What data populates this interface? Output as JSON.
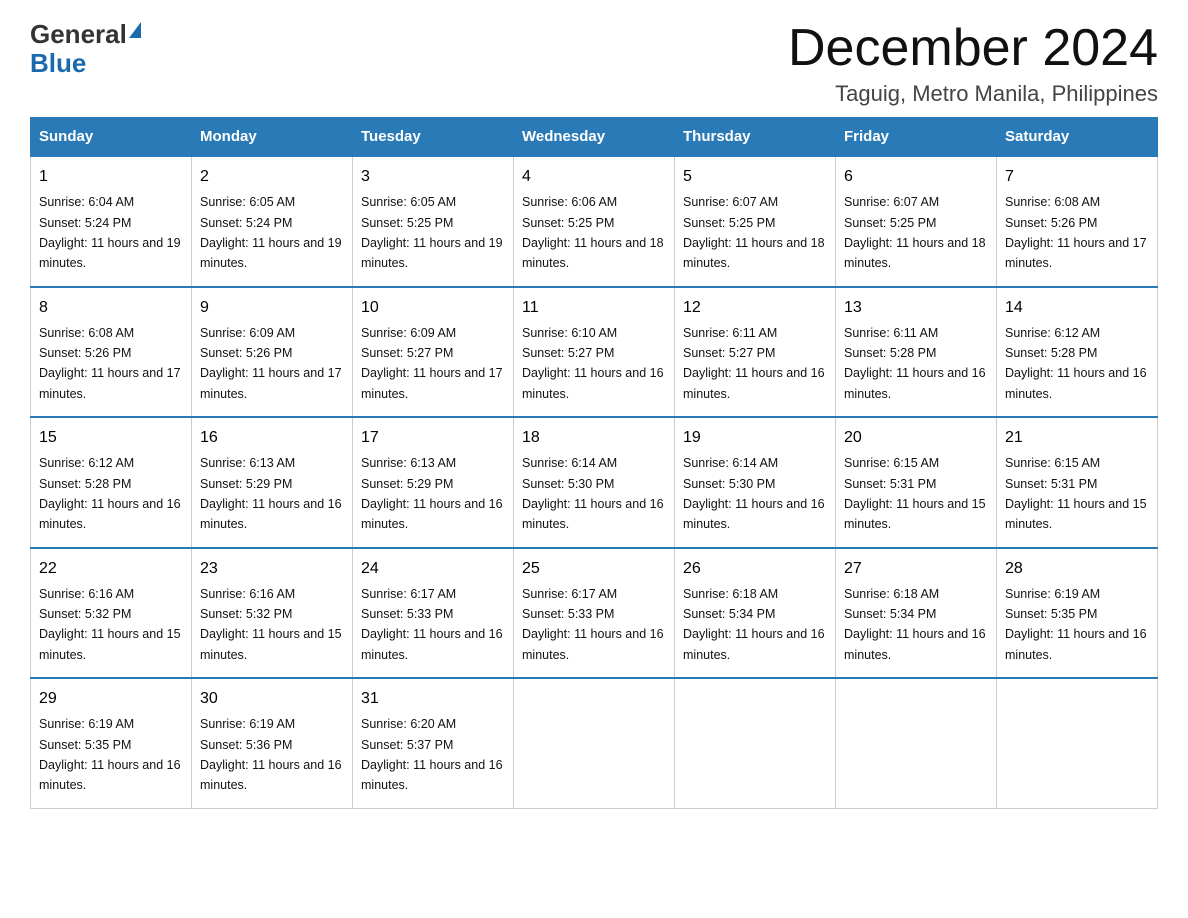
{
  "header": {
    "logo": {
      "general_text": "General",
      "blue_text": "Blue"
    },
    "title": "December 2024",
    "subtitle": "Taguig, Metro Manila, Philippines"
  },
  "calendar": {
    "headers": [
      "Sunday",
      "Monday",
      "Tuesday",
      "Wednesday",
      "Thursday",
      "Friday",
      "Saturday"
    ],
    "weeks": [
      [
        {
          "day": "1",
          "sunrise": "6:04 AM",
          "sunset": "5:24 PM",
          "daylight": "11 hours and 19 minutes."
        },
        {
          "day": "2",
          "sunrise": "6:05 AM",
          "sunset": "5:24 PM",
          "daylight": "11 hours and 19 minutes."
        },
        {
          "day": "3",
          "sunrise": "6:05 AM",
          "sunset": "5:25 PM",
          "daylight": "11 hours and 19 minutes."
        },
        {
          "day": "4",
          "sunrise": "6:06 AM",
          "sunset": "5:25 PM",
          "daylight": "11 hours and 18 minutes."
        },
        {
          "day": "5",
          "sunrise": "6:07 AM",
          "sunset": "5:25 PM",
          "daylight": "11 hours and 18 minutes."
        },
        {
          "day": "6",
          "sunrise": "6:07 AM",
          "sunset": "5:25 PM",
          "daylight": "11 hours and 18 minutes."
        },
        {
          "day": "7",
          "sunrise": "6:08 AM",
          "sunset": "5:26 PM",
          "daylight": "11 hours and 17 minutes."
        }
      ],
      [
        {
          "day": "8",
          "sunrise": "6:08 AM",
          "sunset": "5:26 PM",
          "daylight": "11 hours and 17 minutes."
        },
        {
          "day": "9",
          "sunrise": "6:09 AM",
          "sunset": "5:26 PM",
          "daylight": "11 hours and 17 minutes."
        },
        {
          "day": "10",
          "sunrise": "6:09 AM",
          "sunset": "5:27 PM",
          "daylight": "11 hours and 17 minutes."
        },
        {
          "day": "11",
          "sunrise": "6:10 AM",
          "sunset": "5:27 PM",
          "daylight": "11 hours and 16 minutes."
        },
        {
          "day": "12",
          "sunrise": "6:11 AM",
          "sunset": "5:27 PM",
          "daylight": "11 hours and 16 minutes."
        },
        {
          "day": "13",
          "sunrise": "6:11 AM",
          "sunset": "5:28 PM",
          "daylight": "11 hours and 16 minutes."
        },
        {
          "day": "14",
          "sunrise": "6:12 AM",
          "sunset": "5:28 PM",
          "daylight": "11 hours and 16 minutes."
        }
      ],
      [
        {
          "day": "15",
          "sunrise": "6:12 AM",
          "sunset": "5:28 PM",
          "daylight": "11 hours and 16 minutes."
        },
        {
          "day": "16",
          "sunrise": "6:13 AM",
          "sunset": "5:29 PM",
          "daylight": "11 hours and 16 minutes."
        },
        {
          "day": "17",
          "sunrise": "6:13 AM",
          "sunset": "5:29 PM",
          "daylight": "11 hours and 16 minutes."
        },
        {
          "day": "18",
          "sunrise": "6:14 AM",
          "sunset": "5:30 PM",
          "daylight": "11 hours and 16 minutes."
        },
        {
          "day": "19",
          "sunrise": "6:14 AM",
          "sunset": "5:30 PM",
          "daylight": "11 hours and 16 minutes."
        },
        {
          "day": "20",
          "sunrise": "6:15 AM",
          "sunset": "5:31 PM",
          "daylight": "11 hours and 15 minutes."
        },
        {
          "day": "21",
          "sunrise": "6:15 AM",
          "sunset": "5:31 PM",
          "daylight": "11 hours and 15 minutes."
        }
      ],
      [
        {
          "day": "22",
          "sunrise": "6:16 AM",
          "sunset": "5:32 PM",
          "daylight": "11 hours and 15 minutes."
        },
        {
          "day": "23",
          "sunrise": "6:16 AM",
          "sunset": "5:32 PM",
          "daylight": "11 hours and 15 minutes."
        },
        {
          "day": "24",
          "sunrise": "6:17 AM",
          "sunset": "5:33 PM",
          "daylight": "11 hours and 16 minutes."
        },
        {
          "day": "25",
          "sunrise": "6:17 AM",
          "sunset": "5:33 PM",
          "daylight": "11 hours and 16 minutes."
        },
        {
          "day": "26",
          "sunrise": "6:18 AM",
          "sunset": "5:34 PM",
          "daylight": "11 hours and 16 minutes."
        },
        {
          "day": "27",
          "sunrise": "6:18 AM",
          "sunset": "5:34 PM",
          "daylight": "11 hours and 16 minutes."
        },
        {
          "day": "28",
          "sunrise": "6:19 AM",
          "sunset": "5:35 PM",
          "daylight": "11 hours and 16 minutes."
        }
      ],
      [
        {
          "day": "29",
          "sunrise": "6:19 AM",
          "sunset": "5:35 PM",
          "daylight": "11 hours and 16 minutes."
        },
        {
          "day": "30",
          "sunrise": "6:19 AM",
          "sunset": "5:36 PM",
          "daylight": "11 hours and 16 minutes."
        },
        {
          "day": "31",
          "sunrise": "6:20 AM",
          "sunset": "5:37 PM",
          "daylight": "11 hours and 16 minutes."
        },
        null,
        null,
        null,
        null
      ]
    ]
  }
}
